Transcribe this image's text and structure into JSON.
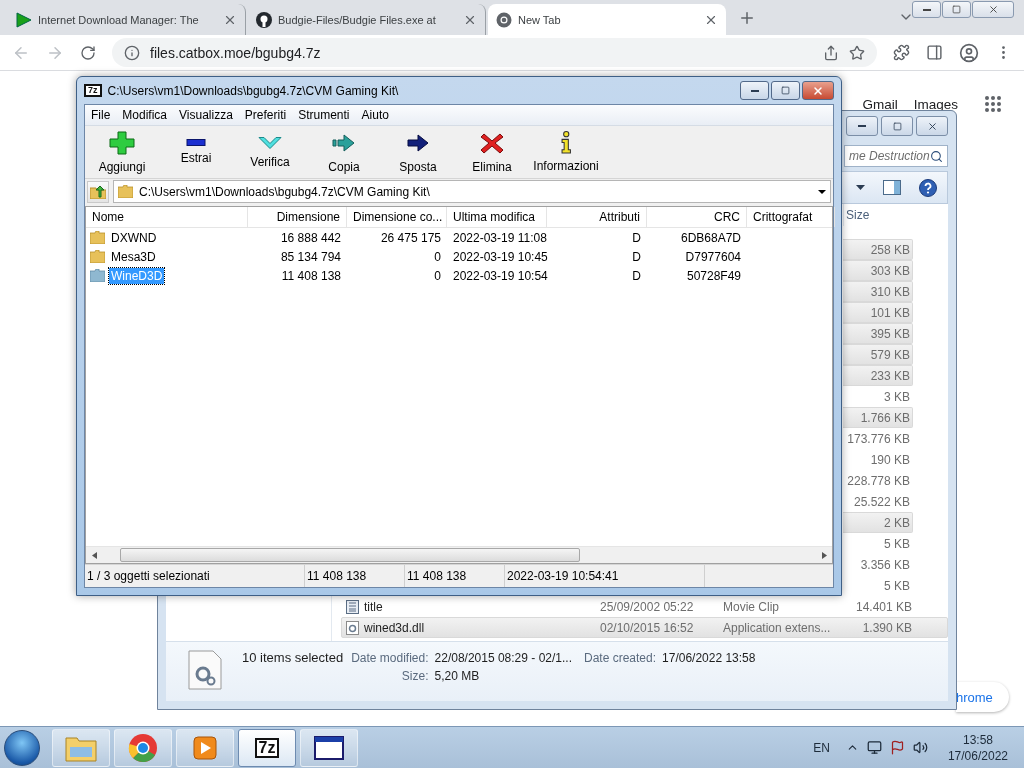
{
  "browser": {
    "tabs": [
      {
        "title": "Internet Download Manager: The",
        "kind": "idm",
        "selected": false
      },
      {
        "title": "Budgie-Files/Budgie Files.exe at",
        "kind": "github",
        "selected": false
      },
      {
        "title": "New Tab",
        "kind": "chrome",
        "selected": true
      }
    ],
    "url": "files.catbox.moe/bgubg4.7z"
  },
  "new_tab_page": {
    "links": [
      "Gmail",
      "Images"
    ],
    "customize_button": "hrome"
  },
  "explorer": {
    "search_placeholder": "me Destruction",
    "size_header": "Size",
    "rows": [
      {
        "size": "258 KB",
        "selected": true
      },
      {
        "size": "303 KB",
        "selected": true
      },
      {
        "size": "310 KB",
        "selected": true
      },
      {
        "size": "101 KB",
        "selected": true
      },
      {
        "size": "395 KB",
        "selected": true
      },
      {
        "size": "579 KB",
        "selected": true
      },
      {
        "size": "233 KB",
        "selected": true
      },
      {
        "size": "3 KB",
        "selected": false
      },
      {
        "size": "1.766 KB",
        "selected": true
      },
      {
        "size": "173.776 KB",
        "selected": false
      },
      {
        "size": "190 KB",
        "selected": false
      },
      {
        "size": "228.778 KB",
        "selected": false
      },
      {
        "size": "25.522 KB",
        "selected": false
      },
      {
        "size": "2 KB",
        "selected": true
      },
      {
        "size": "5 KB",
        "selected": false
      },
      {
        "size": "3.356 KB",
        "selected": false
      },
      {
        "size": "5 KB",
        "selected": false
      },
      {
        "name": "title",
        "kind": "video",
        "date": "25/09/2002 05:22",
        "type": "Movie Clip",
        "size": "14.401 KB",
        "selected": false
      },
      {
        "name": "wined3d.dll",
        "kind": "dll",
        "date": "02/10/2015 16:52",
        "type": "Application extens...",
        "size": "1.390 KB",
        "selected": true
      }
    ],
    "details": {
      "summary": "10 items selected",
      "fields": [
        {
          "label": "Date modified:",
          "value": "22/08/2015 08:29 - 02/1..."
        },
        {
          "label": "Date created:",
          "value": "17/06/2022 13:58"
        },
        {
          "label": "Size:",
          "value": "5,20 MB"
        }
      ]
    }
  },
  "archiver": {
    "icon_label": "7z",
    "title": "C:\\Users\\vm1\\Downloads\\bgubg4.7z\\CVM Gaming Kit\\",
    "menu": [
      "File",
      "Modifica",
      "Visualizza",
      "Preferiti",
      "Strumenti",
      "Aiuto"
    ],
    "toolbar": [
      {
        "label": "Aggiungi",
        "kind": "add"
      },
      {
        "label": "Estrai",
        "kind": "extract"
      },
      {
        "label": "Verifica",
        "kind": "test"
      },
      {
        "label": "Copia",
        "kind": "copy"
      },
      {
        "label": "Sposta",
        "kind": "move"
      },
      {
        "label": "Elimina",
        "kind": "delete"
      },
      {
        "label": "Informazioni",
        "kind": "info"
      }
    ],
    "path": "C:\\Users\\vm1\\Downloads\\bgubg4.7z\\CVM Gaming Kit\\",
    "columns": [
      "Nome",
      "Dimensione",
      "Dimensione co...",
      "Ultima modifica",
      "Attributi",
      "CRC",
      "Crittografat"
    ],
    "rows": [
      {
        "name": "DXWND",
        "size": "16 888 442",
        "packed": "26 475 175",
        "modified": "2022-03-19 11:08",
        "attributes": "D",
        "crc": "6DB68A7D",
        "selected": false
      },
      {
        "name": "Mesa3D",
        "size": "85 134 794",
        "packed": "0",
        "modified": "2022-03-19 10:45",
        "attributes": "D",
        "crc": "D7977604",
        "selected": false
      },
      {
        "name": "WineD3D",
        "size": "11 408 138",
        "packed": "0",
        "modified": "2022-03-19 10:54",
        "attributes": "D",
        "crc": "50728F49",
        "selected": true
      }
    ],
    "status": [
      "1 / 3 oggetti selezionati",
      "11 408 138",
      "11 408 138",
      "2022-03-19 10:54:41"
    ]
  },
  "taskbar": {
    "apps": [
      {
        "kind": "explorer",
        "selected": false
      },
      {
        "kind": "chrome",
        "selected": false
      },
      {
        "kind": "media",
        "selected": false
      },
      {
        "kind": "archiver",
        "label": "7z",
        "selected": true
      },
      {
        "kind": "window",
        "selected": false
      }
    ],
    "language": "EN",
    "time": "13:58",
    "date": "17/06/2022"
  }
}
